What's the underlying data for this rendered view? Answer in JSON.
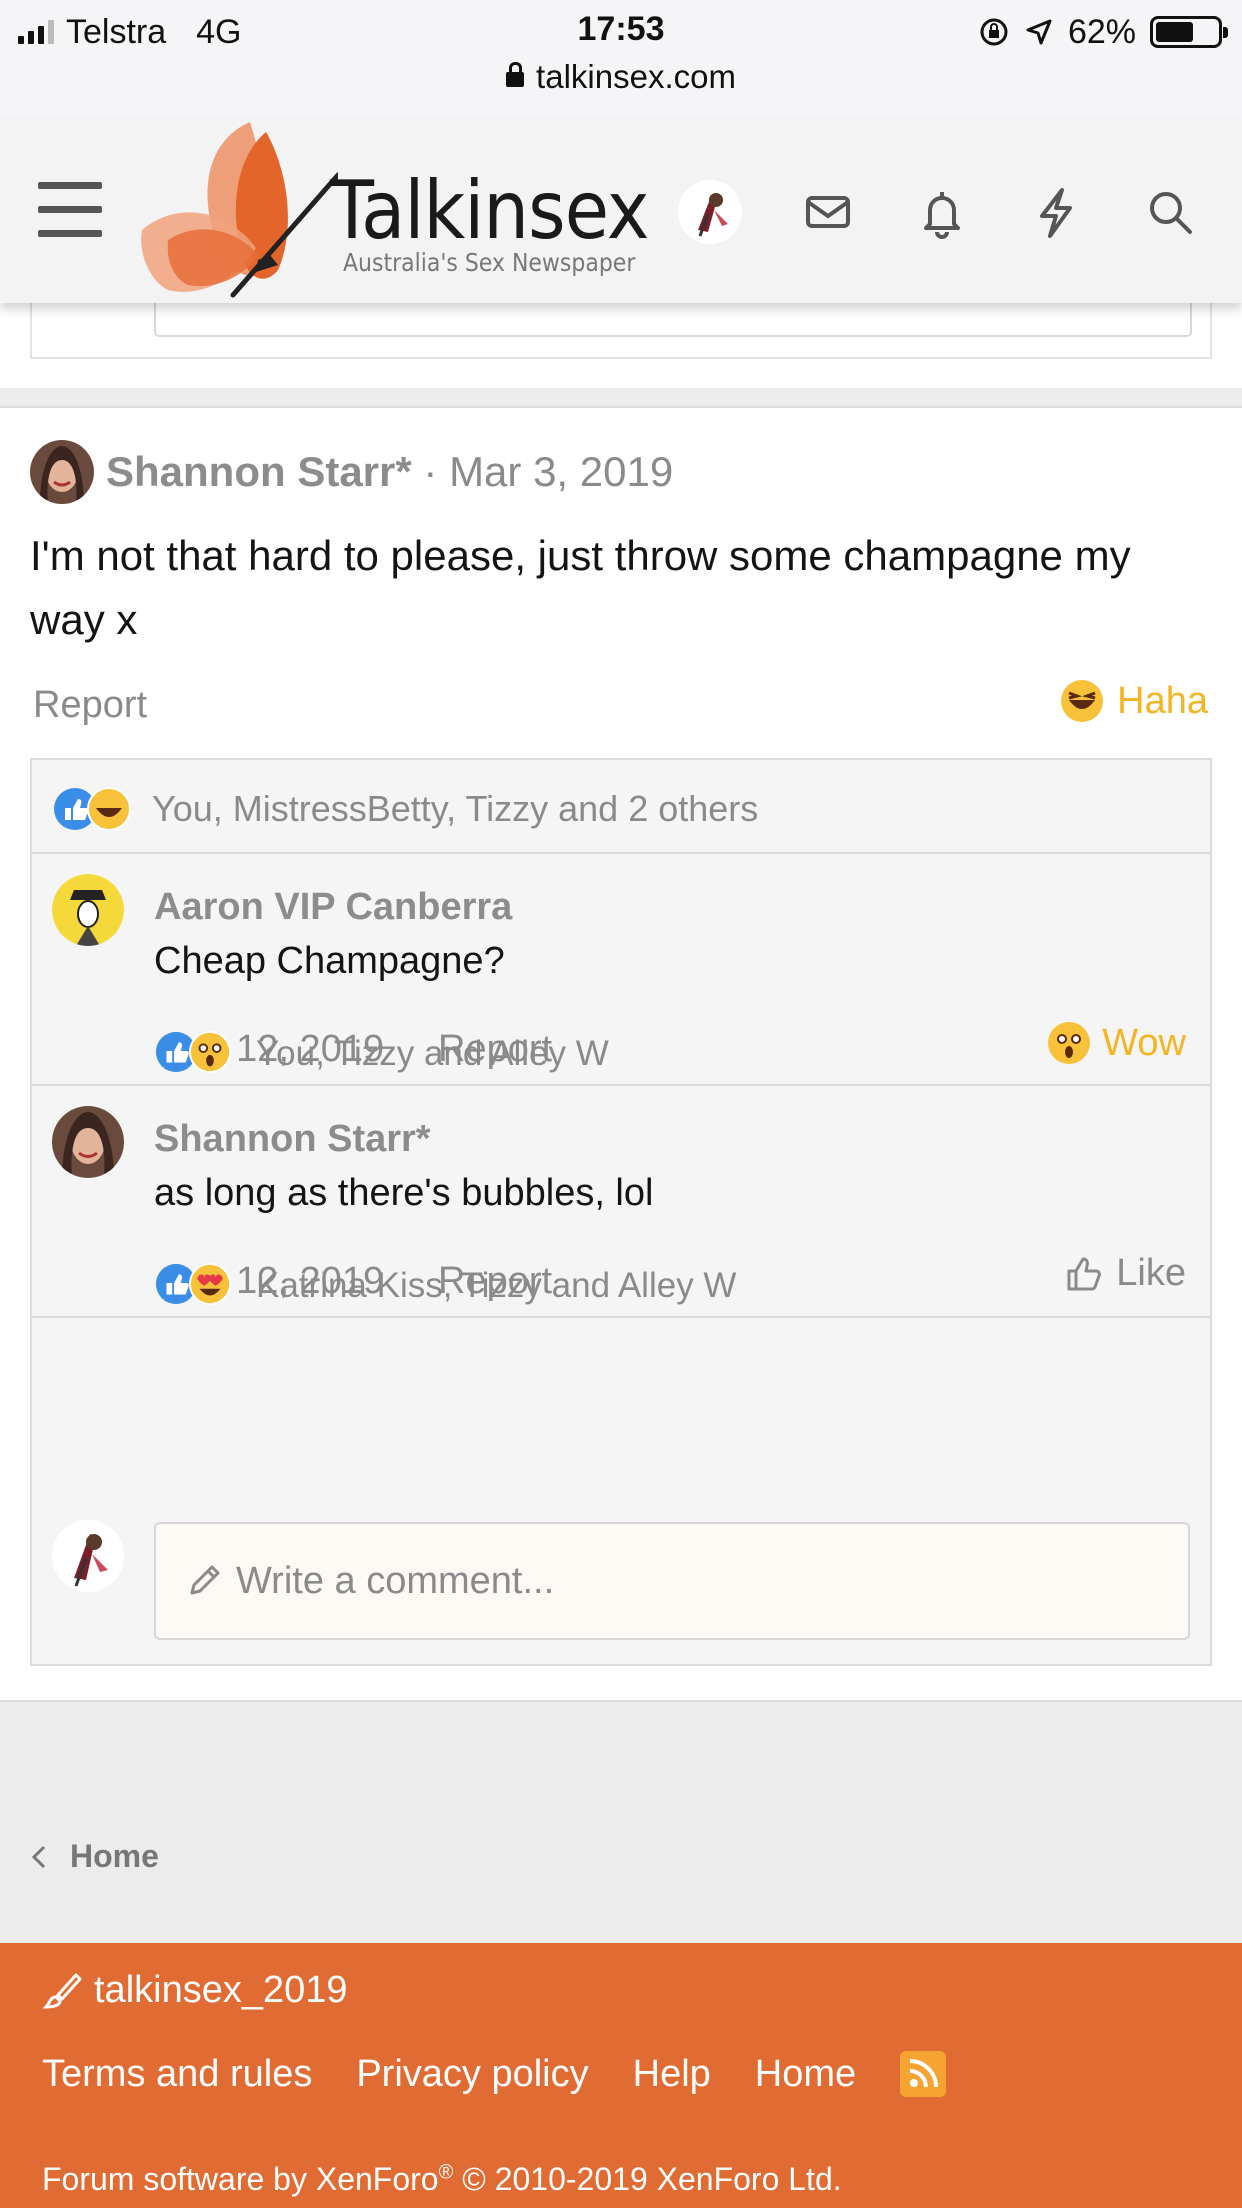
{
  "status_bar": {
    "carrier": "Telstra",
    "network": "4G",
    "time": "17:53",
    "battery_percent": "62%",
    "battery_level": 0.62,
    "url": "talkinsex.com"
  },
  "header": {
    "logo_title": "Talkinsex",
    "logo_tagline": "Australia's Sex Newspaper",
    "icons": [
      "menu-icon",
      "user-avatar",
      "mail-icon",
      "bell-icon",
      "bolt-icon",
      "search-icon"
    ],
    "brand_color": "#e06b33"
  },
  "post": {
    "author": "Shannon Starr*",
    "date": "Mar 3, 2019",
    "separator": "·",
    "text": "I'm not that hard to please, just throw some champagne my way x",
    "report_label": "Report",
    "reaction_label": "Haha",
    "reaction_color": "#f3b526"
  },
  "reactions_summary": {
    "icons": [
      "like-icon",
      "haha-icon"
    ],
    "text": "You, MistressBetty, Tizzy and 2 others"
  },
  "comments": [
    {
      "author": "Aaron VIP Canberra",
      "text": "Cheap Champagne?",
      "date": "Aug 12, 2019",
      "report_label": "Report",
      "reaction_label": "Wow",
      "reaction_icon": "wow-icon",
      "reactions_icons": [
        "like-icon",
        "wow-icon"
      ],
      "reactions_text": "You, Tizzy and Alley W"
    },
    {
      "author": "Shannon Starr*",
      "text": "as long as there's bubbles, lol",
      "date": "Aug 12, 2019",
      "report_label": "Report",
      "reaction_label": "Like",
      "reaction_icon": "thumbs-up-outline-icon",
      "reactions_icons": [
        "like-icon",
        "love-icon"
      ],
      "reactions_text": "Katrina Kiss, Tizzy and Alley W"
    }
  ],
  "write_comment": {
    "placeholder": "Write a comment..."
  },
  "breadcrumb": {
    "label": "Home"
  },
  "footer": {
    "style_name": "talkinsex_2019",
    "links": [
      "Terms and rules",
      "Privacy policy",
      "Help",
      "Home"
    ],
    "copyright_prefix": "Forum software by XenForo",
    "copyright_mark": "®",
    "copyright_suffix": " © 2010-2019 XenForo Ltd."
  }
}
